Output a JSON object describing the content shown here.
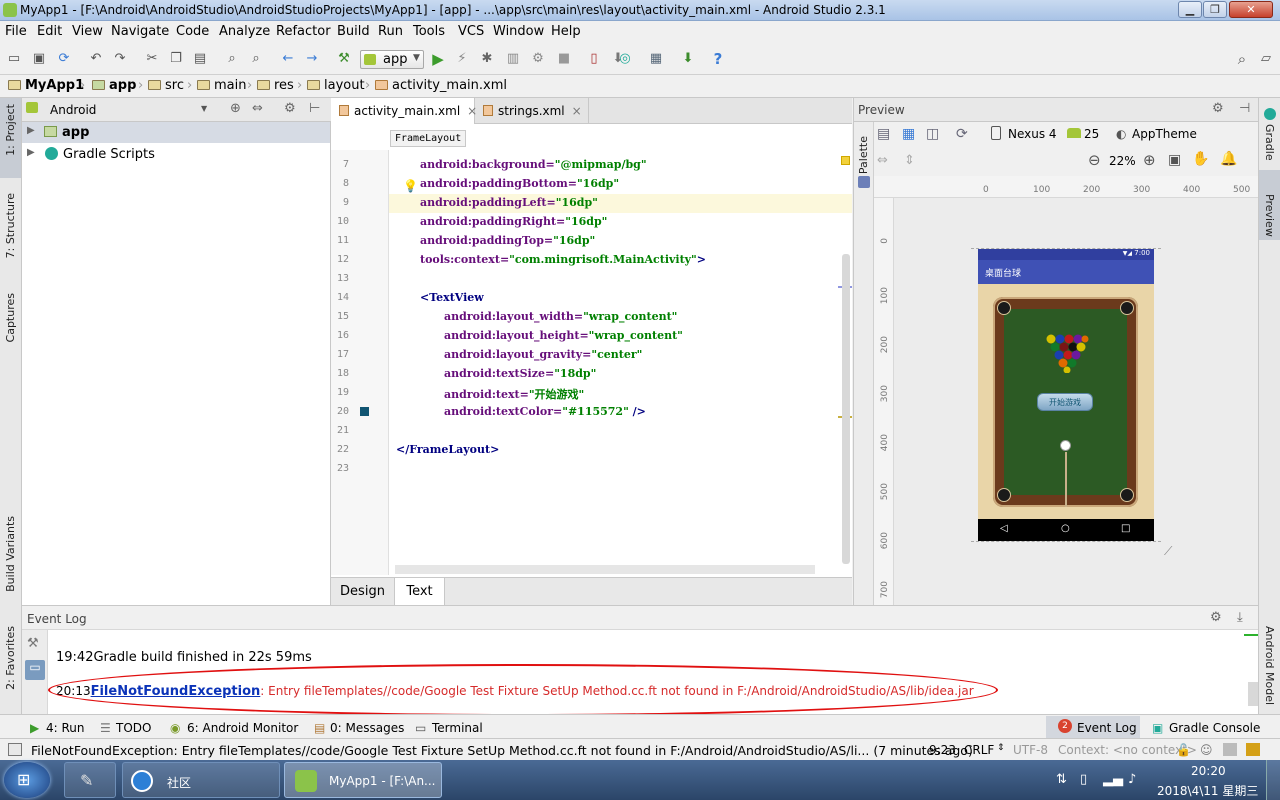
{
  "window": {
    "title": "MyApp1 - [F:\\Android\\AndroidStudio\\AndroidStudioProjects\\MyApp1] - [app] - ...\\app\\src\\main\\res\\layout\\activity_main.xml - Android Studio 2.3.1"
  },
  "menu": [
    "File",
    "Edit",
    "View",
    "Navigate",
    "Code",
    "Analyze",
    "Refactor",
    "Build",
    "Run",
    "Tools",
    "VCS",
    "Window",
    "Help"
  ],
  "toolbar": {
    "run_config": "app",
    "help": "?"
  },
  "breadcrumb": [
    "MyApp1",
    "app",
    "src",
    "main",
    "res",
    "layout",
    "activity_main.xml"
  ],
  "left_tools": [
    "1: Project",
    "7: Structure",
    "Captures",
    "Build Variants",
    "2: Favorites"
  ],
  "right_tools": [
    "Gradle",
    "Preview",
    "Android Model"
  ],
  "project": {
    "view": "Android",
    "items": [
      "app",
      "Gradle Scripts"
    ]
  },
  "editor": {
    "tabs": [
      "activity_main.xml",
      "strings.xml"
    ],
    "tooltip": "FrameLayout",
    "lines": [
      {
        "n": "7",
        "parts": [
          [
            "attr",
            "android:background="
          ],
          [
            "val",
            "\"@mipmap/bg\""
          ]
        ],
        "indent": 0
      },
      {
        "n": "8",
        "parts": [
          [
            "attr",
            "android:paddingBottom="
          ],
          [
            "val",
            "\"16dp\""
          ]
        ],
        "indent": 0
      },
      {
        "n": "9",
        "parts": [
          [
            "attr",
            "android:paddingLeft="
          ],
          [
            "val",
            "\"16dp\""
          ]
        ],
        "indent": 0
      },
      {
        "n": "10",
        "parts": [
          [
            "attr",
            "android:paddingRight="
          ],
          [
            "val",
            "\"16dp\""
          ]
        ],
        "indent": 0
      },
      {
        "n": "11",
        "parts": [
          [
            "attr",
            "android:paddingTop="
          ],
          [
            "val",
            "\"16dp\""
          ]
        ],
        "indent": 0
      },
      {
        "n": "12",
        "parts": [
          [
            "attr",
            "tools:context="
          ],
          [
            "val",
            "\"com.mingrisoft.MainActivity\""
          ],
          [
            "tag",
            ">"
          ]
        ],
        "indent": 0
      },
      {
        "n": "13",
        "parts": [],
        "indent": 0
      },
      {
        "n": "14",
        "parts": [
          [
            "tag",
            "<TextView"
          ]
        ],
        "indent": 0
      },
      {
        "n": "15",
        "parts": [
          [
            "attr",
            "android:layout_width="
          ],
          [
            "val",
            "\"wrap_content\""
          ]
        ],
        "indent": 1
      },
      {
        "n": "16",
        "parts": [
          [
            "attr",
            "android:layout_height="
          ],
          [
            "val",
            "\"wrap_content\""
          ]
        ],
        "indent": 1
      },
      {
        "n": "17",
        "parts": [
          [
            "attr",
            "android:layout_gravity="
          ],
          [
            "val",
            "\"center\""
          ]
        ],
        "indent": 1
      },
      {
        "n": "18",
        "parts": [
          [
            "attr",
            "android:textSize="
          ],
          [
            "val",
            "\"18dp\""
          ]
        ],
        "indent": 1
      },
      {
        "n": "19",
        "parts": [
          [
            "attr",
            "android:text="
          ],
          [
            "val",
            "\"开始游戏\""
          ]
        ],
        "indent": 1
      },
      {
        "n": "20",
        "parts": [
          [
            "attr",
            "android:textColor="
          ],
          [
            "val",
            "\"#115572\""
          ],
          [
            "tag",
            " />"
          ]
        ],
        "indent": 1
      },
      {
        "n": "21",
        "parts": [],
        "indent": 0
      },
      {
        "n": "22",
        "parts": [
          [
            "tag",
            "</FrameLayout>"
          ]
        ],
        "indent": -1
      },
      {
        "n": "23",
        "parts": [],
        "indent": 0
      }
    ],
    "bottom_tabs": [
      "Design",
      "Text"
    ]
  },
  "preview": {
    "title": "Preview",
    "palette": "Palette",
    "device": "Nexus 4",
    "api": "25",
    "theme": "AppTheme",
    "zoom": "22%",
    "hruler": [
      "0",
      "100",
      "200",
      "300",
      "400",
      "500"
    ],
    "vruler": [
      "0",
      "100",
      "200",
      "300",
      "400",
      "500",
      "600",
      "700"
    ],
    "phone": {
      "time": "7:00",
      "app_title": "桌面台球",
      "button": "开始游戏"
    }
  },
  "event_log": {
    "title": "Event Log",
    "entries": [
      {
        "time": "19:42",
        "text": "Gradle build finished in 22s 59ms"
      },
      {
        "time": "20:13",
        "link": "FileNotFoundException",
        "text": ": Entry fileTemplates//code/Google Test Fixture SetUp Method.cc.ft not found in F:/Android/AndroidStudio/AS/lib/idea.jar"
      }
    ]
  },
  "bottom_tools": {
    "run": "4: Run",
    "todo": "TODO",
    "monitor": "6: Android Monitor",
    "messages": "0: Messages",
    "terminal": "Terminal",
    "event_log_count": "2",
    "event_log": "Event Log",
    "gradle_console": "Gradle Console"
  },
  "status": {
    "message": "FileNotFoundException: Entry fileTemplates//code/Google Test Fixture SetUp Method.cc.ft not found in F:/Android/AndroidStudio/AS/li... (7 minutes ago)",
    "position": "9:23",
    "line_sep": "CRLF",
    "encoding": "UTF-8",
    "context": "Context: <no context>"
  },
  "taskbar": {
    "items": [
      "社区",
      "MyApp1 - [F:\\An..."
    ],
    "time": "20:20",
    "date": "2018\\4\\11 星期三"
  },
  "colors": {
    "accent_blue": "#3f51b5",
    "error_red": "#d62b2b",
    "link_blue": "#0b33b8"
  }
}
